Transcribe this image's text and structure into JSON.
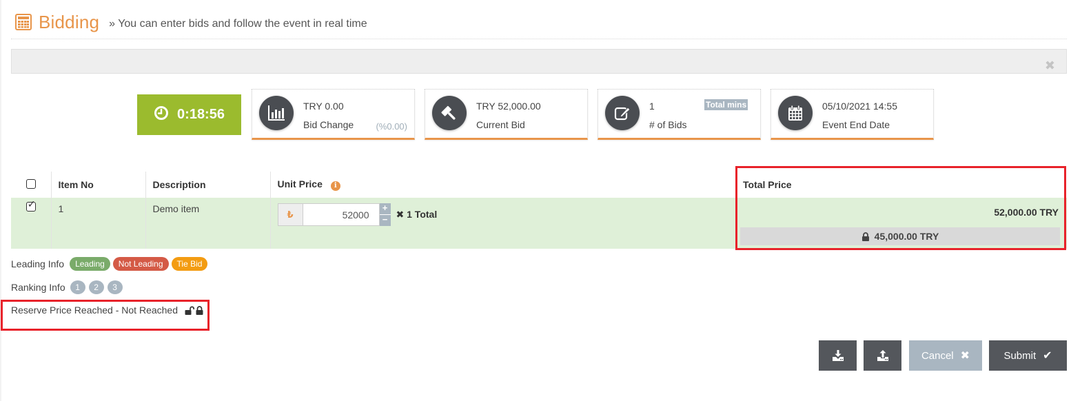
{
  "header": {
    "title": "Bidding",
    "subtitle": "» You can enter bids and follow the event in real time",
    "icon": "calculator-icon"
  },
  "alert": {
    "close_glyph": "✖"
  },
  "timer": {
    "value": "0:18:56",
    "icon": "clock-icon",
    "color": "#9bbb2e"
  },
  "stats": [
    {
      "icon": "bar-chart-icon",
      "value": "TRY 0.00",
      "label": "Bid Change",
      "extra": "(%0.00)"
    },
    {
      "icon": "gavel-icon",
      "value": "TRY 52,000.00",
      "label": "Current Bid"
    },
    {
      "icon": "edit-icon",
      "value": "1",
      "label": "# of Bids",
      "badge": "Total  mins"
    },
    {
      "icon": "calendar-icon",
      "value": "05/10/2021 14:55",
      "label": "Event End Date"
    }
  ],
  "table": {
    "headers": {
      "select_all_checked": false,
      "item_no": "Item No",
      "description": "Description",
      "unit_price": "Unit Price",
      "unit_price_info_glyph": "i",
      "total_price": "Total Price"
    },
    "rows": [
      {
        "checked": true,
        "item_no": "1",
        "description": "Demo item",
        "currency_symbol": "₺",
        "unit_price": "52000",
        "spinner_up": "+",
        "spinner_down": "−",
        "quantity_prefix": "✖",
        "quantity_text": " 1 Total",
        "total_price": "52,000.00 TRY",
        "reserve_price": "45,000.00 TRY"
      }
    ]
  },
  "legend": {
    "leading_label": "Leading Info",
    "leading_badges": [
      {
        "label": "Leading",
        "color": "#7aab6a"
      },
      {
        "label": "Not Leading",
        "color": "#d45a46"
      },
      {
        "label": "Tie Bid",
        "color": "#f39c12"
      }
    ],
    "ranking_label": "Ranking Info",
    "ranking_badges": [
      "1",
      "2",
      "3"
    ],
    "reserve_label": "Reserve Price Reached - Not Reached"
  },
  "actions": {
    "download_icon": "download-icon",
    "upload_icon": "upload-icon",
    "cancel_label": "Cancel",
    "cancel_glyph": "✖",
    "submit_label": "Submit",
    "submit_glyph": "✔"
  },
  "colors": {
    "accent": "#e8954a",
    "highlight": "#e8222a",
    "row_bg": "#dff0d8",
    "dark_button": "#54575c",
    "muted": "#a9b6c1"
  }
}
